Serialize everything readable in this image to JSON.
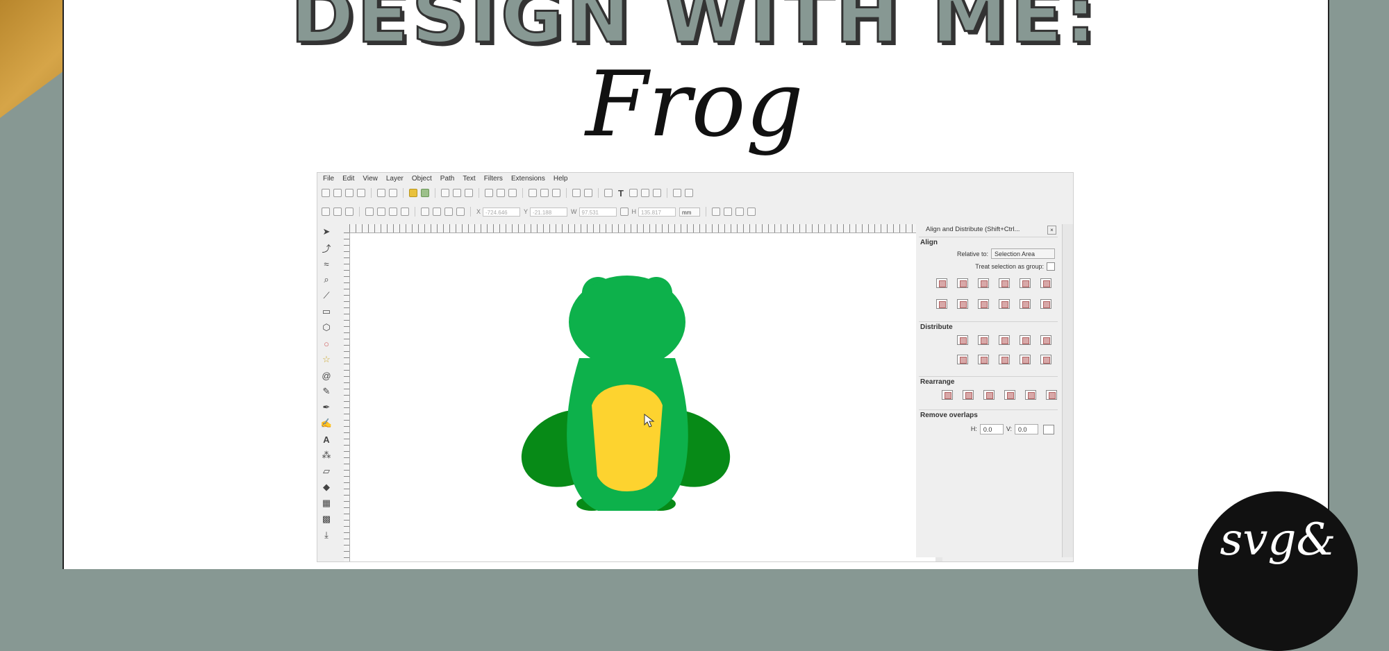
{
  "poster": {
    "title": "DESIGN WITH ME:",
    "subtitle": "Frog",
    "logo_text": "svg&"
  },
  "app": {
    "menu": [
      "File",
      "Edit",
      "View",
      "Layer",
      "Object",
      "Path",
      "Text",
      "Filters",
      "Extensions",
      "Help"
    ],
    "toolbar_fields": [
      {
        "label": "X",
        "value": "-724.646"
      },
      {
        "label": "Y",
        "value": "-21.188"
      },
      {
        "label": "W",
        "value": "97.531"
      },
      {
        "label": "H",
        "value": "135.817"
      }
    ],
    "unit": "mm",
    "dock": {
      "title": "Align and Distribute (Shift+Ctrl...",
      "close": "×",
      "align_label": "Align",
      "relative_to_label": "Relative to:",
      "relative_to_value": "Selection Area",
      "treat_group_label": "Treat selection as group:",
      "distribute_label": "Distribute",
      "rearrange_label": "Rearrange",
      "remove_overlaps_label": "Remove overlaps",
      "h_label": "H:",
      "h_value": "0.0",
      "v_label": "V:",
      "v_value": "0.0"
    }
  },
  "colors": {
    "frog_body": "#0db14b",
    "frog_legs": "#078a17",
    "frog_belly": "#fdd32f",
    "background": "#879893",
    "gold": "#c8963a"
  }
}
